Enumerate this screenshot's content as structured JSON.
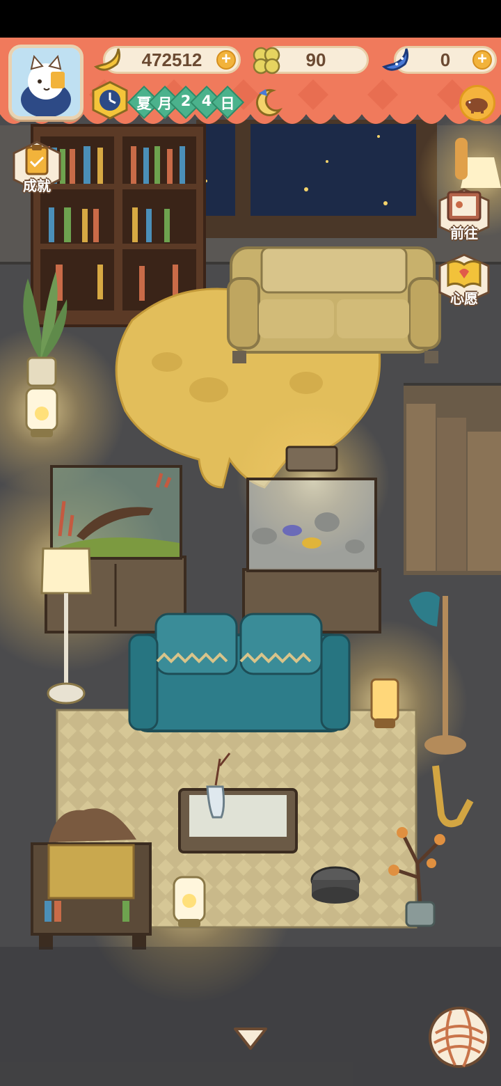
{
  "hud": {
    "bananas": "472512",
    "clovers": "90",
    "blue_bananas": "0",
    "season": "夏",
    "month_char": "月",
    "day_digit_1": "2",
    "day_digit_2": "4",
    "day_char": "日",
    "plus_symbol": "+"
  },
  "side_buttons": {
    "achievements": "成就",
    "goto": "前往",
    "wishes": "心愿"
  },
  "colors": {
    "banner": "#f07a5c",
    "banner_dark": "#e2654a",
    "floor": "#4b4b4d",
    "accent_green": "#4bb28c",
    "sofa_teal": "#2d7d8a"
  },
  "icons": {
    "avatar": "cat-avatar-icon",
    "banana": "banana-icon",
    "clover": "clover-icon",
    "blue_banana": "blue-banana-icon",
    "clock": "clock-icon",
    "moon": "moon-icon",
    "boar": "boar-icon",
    "down": "chevron-down-icon",
    "yarn": "yarn-ball-icon"
  }
}
